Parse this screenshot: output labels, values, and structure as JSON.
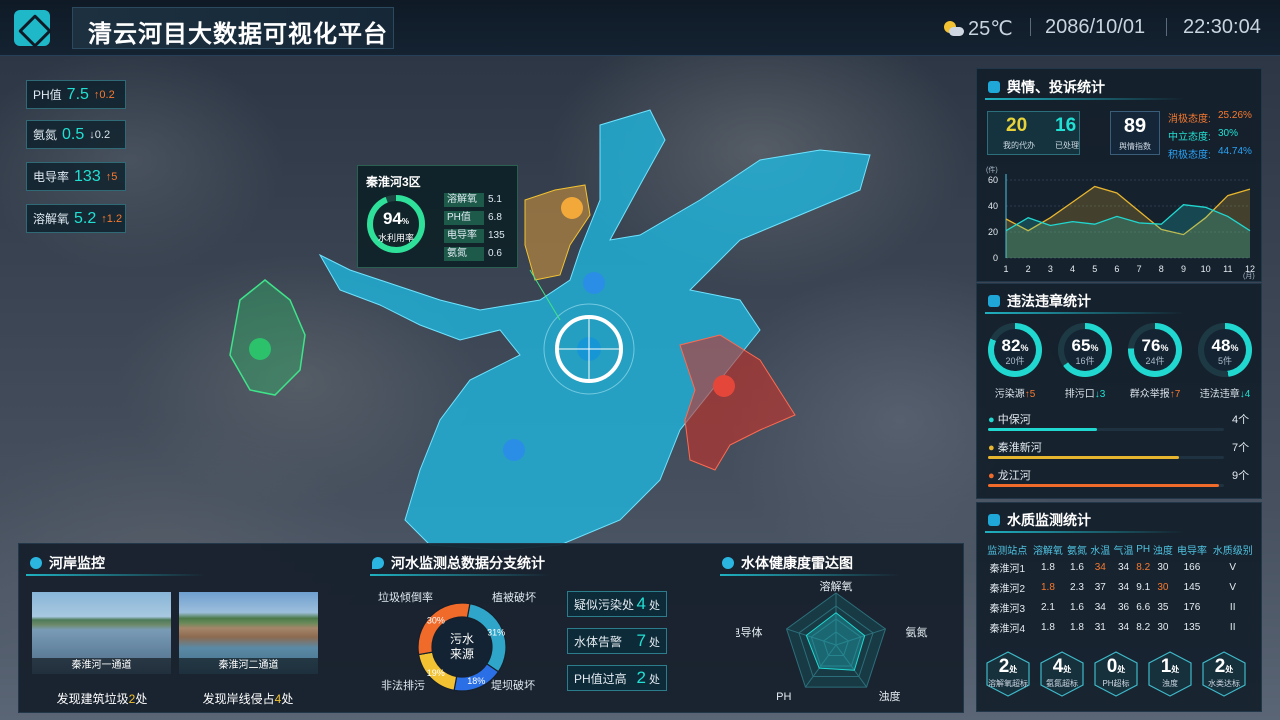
{
  "header": {
    "title": "清云河目大数据可视化平台",
    "temperature": "25℃",
    "date": "2086/10/01",
    "time": "22:30:04"
  },
  "indicators": [
    {
      "label": "PH值",
      "value": "7.5",
      "change": "0.2",
      "dir": "up"
    },
    {
      "label": "氨氮",
      "value": "0.5",
      "change": "0.2",
      "dir": "down"
    },
    {
      "label": "电导率",
      "value": "133",
      "change": "5",
      "dir": "up"
    },
    {
      "label": "溶解氧",
      "value": "5.2",
      "change": "1.2",
      "dir": "up"
    }
  ],
  "popup": {
    "title": "秦淮河3区",
    "gauge_value": "94",
    "gauge_unit": "%",
    "gauge_label": "水利用率",
    "gauge_fraction": 0.94,
    "metrics": [
      {
        "k": "溶解氧",
        "v": "5.1"
      },
      {
        "k": "PH值",
        "v": "6.8"
      },
      {
        "k": "电导率",
        "v": "135"
      },
      {
        "k": "氨氮",
        "v": "0.6"
      }
    ]
  },
  "opinion": {
    "title": "舆情、投诉统计",
    "stats": [
      {
        "v": "20",
        "l": "我的代办"
      },
      {
        "v": "16",
        "l": "已处理"
      }
    ],
    "index": {
      "v": "89",
      "l": "舆情指数"
    },
    "sentiment": [
      {
        "l": "消极态度:",
        "v": "25.26%",
        "c": "#f7792f"
      },
      {
        "l": "中立态度:",
        "v": "30%",
        "c": "#21e0d3"
      },
      {
        "l": "积极态度:",
        "v": "44.74%",
        "c": "#2aa3f5"
      }
    ]
  },
  "chart_data": {
    "type": "line",
    "unit_label": "(件)",
    "categories": [
      "1",
      "2",
      "3",
      "4",
      "5",
      "6",
      "7",
      "8",
      "9",
      "10",
      "11",
      "12"
    ],
    "x_unit": "(月)",
    "ylim": [
      0,
      60
    ],
    "yticks": [
      "0",
      "20",
      "40",
      "60"
    ],
    "series": [
      {
        "values": [
          30,
          21,
          31,
          43,
          55,
          50,
          36,
          22,
          18,
          31,
          48,
          53
        ],
        "color": "#e8b52e"
      },
      {
        "values": [
          21,
          31,
          25,
          28,
          26,
          32,
          27,
          26,
          41,
          39,
          32,
          21
        ],
        "color": "#21d8d0"
      }
    ]
  },
  "violation": {
    "title": "违法违章统计",
    "rings": [
      {
        "pct": "82",
        "cnt": "20件",
        "label": "污染源",
        "chg": "5",
        "dir": "up",
        "frac": 0.82
      },
      {
        "pct": "65",
        "cnt": "16件",
        "label": "排污口",
        "chg": "3",
        "dir": "down",
        "frac": 0.65
      },
      {
        "pct": "76",
        "cnt": "24件",
        "label": "群众举报",
        "chg": "7",
        "dir": "up",
        "frac": 0.76
      },
      {
        "pct": "48",
        "cnt": "5件",
        "label": "违法违章",
        "chg": "4",
        "dir": "down",
        "frac": 0.48
      }
    ],
    "rank": [
      {
        "name": "中保河",
        "count": "4个",
        "frac": 0.46,
        "color": "#21d8d0"
      },
      {
        "name": "秦淮新河",
        "count": "7个",
        "frac": 0.81,
        "color": "#e8b52e"
      },
      {
        "name": "龙江河",
        "count": "9个",
        "frac": 0.98,
        "color": "#f06a2a"
      }
    ]
  },
  "water": {
    "title": "水质监测统计",
    "headers": [
      "监测站点",
      "溶解氧",
      "氨氮",
      "水温",
      "气温",
      "PH",
      "浊度",
      "电导率",
      "水质级别"
    ],
    "rows": [
      [
        "秦淮河1",
        "1.8",
        "1.6",
        "34",
        "34",
        "8.2",
        "30",
        "166",
        "V"
      ],
      [
        "秦淮河2",
        "1.8",
        "2.3",
        "37",
        "34",
        "9.1",
        "30",
        "145",
        "V"
      ],
      [
        "秦淮河3",
        "2.1",
        "1.6",
        "34",
        "36",
        "6.6",
        "35",
        "176",
        "II"
      ],
      [
        "秦淮河4",
        "1.8",
        "1.8",
        "31",
        "34",
        "8.2",
        "30",
        "135",
        "II"
      ]
    ],
    "highlight": [
      [
        1,
        3
      ],
      [
        1,
        5
      ],
      [
        2,
        1
      ],
      [
        2,
        6
      ]
    ],
    "badges": [
      {
        "n": "2",
        "l": "溶解氧超标"
      },
      {
        "n": "4",
        "l": "氨氮超标"
      },
      {
        "n": "0",
        "l": "PH超标"
      },
      {
        "n": "1",
        "l": "浊度"
      },
      {
        "n": "2",
        "l": "水类达标"
      }
    ],
    "badge_unit": "处"
  },
  "shore": {
    "title": "河岸监控",
    "cams": [
      {
        "name": "秦淮河一通道",
        "caption_pre": "发现建筑垃圾",
        "caption_num": "2",
        "caption_post": "处"
      },
      {
        "name": "秦淮河二通道",
        "caption_pre": "发现岸线侵占",
        "caption_num": "4",
        "caption_post": "处"
      }
    ]
  },
  "source": {
    "title": "河水监测总数据分支统计",
    "center": "污水\n来源",
    "center_l1": "污水",
    "center_l2": "来源",
    "slices": [
      {
        "label": "植被破坏",
        "pct": "31%",
        "value": 31,
        "color": "#2fa6c9"
      },
      {
        "label": "堤坝破坏",
        "pct": "18%",
        "value": 18,
        "color": "#2a6fe6"
      },
      {
        "label": "非法排污",
        "pct": "19%",
        "value": 19,
        "color": "#f2c232"
      },
      {
        "label": "垃圾倾倒率",
        "pct": "30%",
        "value": 30,
        "color": "#f06a2a"
      }
    ],
    "stats": [
      {
        "label": "疑似污染处",
        "v": "4",
        "u": "处"
      },
      {
        "label": "水体告警",
        "v": "7",
        "u": "处"
      },
      {
        "label": "PH值过高",
        "v": "2",
        "u": "处"
      }
    ]
  },
  "radar": {
    "title": "水体健康度雷达图",
    "axes": [
      "溶解氧",
      "氨氮",
      "浊度",
      "PH",
      "电导体"
    ],
    "values": [
      0.62,
      0.58,
      0.6,
      0.55,
      0.6
    ]
  }
}
